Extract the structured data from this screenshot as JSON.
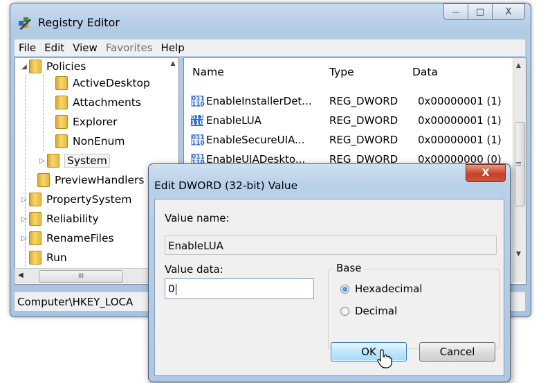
{
  "window": {
    "title": "Registry Editor",
    "caption_min": "—",
    "caption_max": "□",
    "caption_close": "X"
  },
  "menu": [
    "File",
    "Edit",
    "View",
    "Favorites",
    "Help"
  ],
  "tree": {
    "items": [
      {
        "label": "Policies"
      },
      {
        "label": "ActiveDesktop"
      },
      {
        "label": "Attachments"
      },
      {
        "label": "Explorer"
      },
      {
        "label": "NonEnum"
      },
      {
        "label": "System"
      },
      {
        "label": "PreviewHandlers"
      },
      {
        "label": "PropertySystem"
      },
      {
        "label": "Reliability"
      },
      {
        "label": "RenameFiles"
      },
      {
        "label": "Run"
      }
    ],
    "hscroll_grip": "III"
  },
  "list": {
    "columns": [
      "Name",
      "Type",
      "Data"
    ],
    "rows": [
      {
        "name": "EnableInstallerDet...",
        "type": "REG_DWORD",
        "data": "0x00000001 (1)"
      },
      {
        "name": "EnableLUA",
        "type": "REG_DWORD",
        "data": "0x00000001 (1)"
      },
      {
        "name": "EnableSecureUIA...",
        "type": "REG_DWORD",
        "data": "0x00000001 (1)"
      },
      {
        "name": "EnableUIADeskto...",
        "type": "REG_DWORD",
        "data": "0x00000000 (0)"
      }
    ],
    "icon_text": "011\n110"
  },
  "status": {
    "path": "Computer\\HKEY_LOCA"
  },
  "dialog": {
    "title": "Edit DWORD (32-bit) Value",
    "value_name_label": "Value name:",
    "value_name": "EnableLUA",
    "value_data_label": "Value data:",
    "value_data": "0",
    "base_label": "Base",
    "hex_label": "Hexadecimal",
    "dec_label": "Decimal",
    "base_selected": "Hexadecimal",
    "ok_label": "OK",
    "cancel_label": "Cancel",
    "close_glyph": "X"
  }
}
